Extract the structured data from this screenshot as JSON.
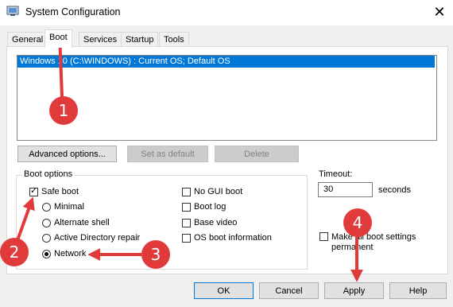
{
  "window": {
    "title": "System Configuration",
    "close_symbol": "✕"
  },
  "tabs": [
    {
      "label": "General"
    },
    {
      "label": "Boot"
    },
    {
      "label": "Services"
    },
    {
      "label": "Startup"
    },
    {
      "label": "Tools"
    }
  ],
  "os_list": {
    "selected_entry": "Windows 10 (C:\\WINDOWS) : Current OS; Default OS"
  },
  "os_buttons": {
    "advanced": "Advanced options...",
    "set_default": "Set as default",
    "delete": "Delete"
  },
  "boot_options": {
    "group_label": "Boot options",
    "safe_boot": "Safe boot",
    "minimal": "Minimal",
    "alternate_shell": "Alternate shell",
    "active_directory_repair": "Active Directory repair",
    "network": "Network",
    "no_gui_boot": "No GUI boot",
    "boot_log": "Boot log",
    "base_video": "Base video",
    "os_boot_information": "OS boot information"
  },
  "timeout": {
    "label": "Timeout:",
    "value": "30",
    "unit": "seconds"
  },
  "make_permanent": {
    "label_line1": "Make all boot settings",
    "label_line2": "permanent"
  },
  "footer": {
    "ok": "OK",
    "cancel": "Cancel",
    "apply": "Apply",
    "help": "Help"
  },
  "annotations": {
    "m1": "1",
    "m2": "2",
    "m3": "3",
    "m4": "4",
    "color": "#e03a3a"
  }
}
